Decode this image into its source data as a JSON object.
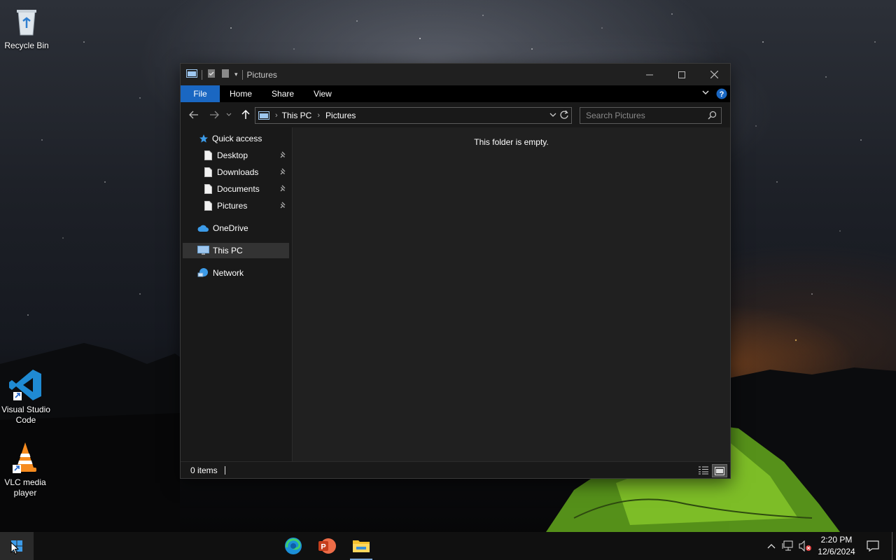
{
  "desktop": {
    "icons": [
      {
        "label": "Recycle Bin"
      },
      {
        "label": "Visual Studio Code"
      },
      {
        "label": "VLC media player"
      }
    ]
  },
  "window": {
    "title": "Pictures",
    "ribbon_tabs": [
      "File",
      "Home",
      "Share",
      "View"
    ],
    "address": {
      "crumbs": [
        "This PC",
        "Pictures"
      ]
    },
    "search_placeholder": "Search Pictures",
    "nav": {
      "quick_access": "Quick access",
      "pinned": [
        "Desktop",
        "Downloads",
        "Documents",
        "Pictures"
      ],
      "onedrive": "OneDrive",
      "this_pc": "This PC",
      "network": "Network"
    },
    "empty_message": "This folder is empty.",
    "status": {
      "items": "0 items"
    }
  },
  "taskbar": {
    "apps": [
      "edge-icon",
      "powerpoint-icon",
      "file-explorer-icon"
    ],
    "clock": {
      "time": "2:20 PM",
      "date": "12/6/2024"
    }
  },
  "colors": {
    "accent": "#1a67c2",
    "window_bg": "#191919",
    "content_bg": "#202020",
    "taskbar_bg": "#101010"
  }
}
